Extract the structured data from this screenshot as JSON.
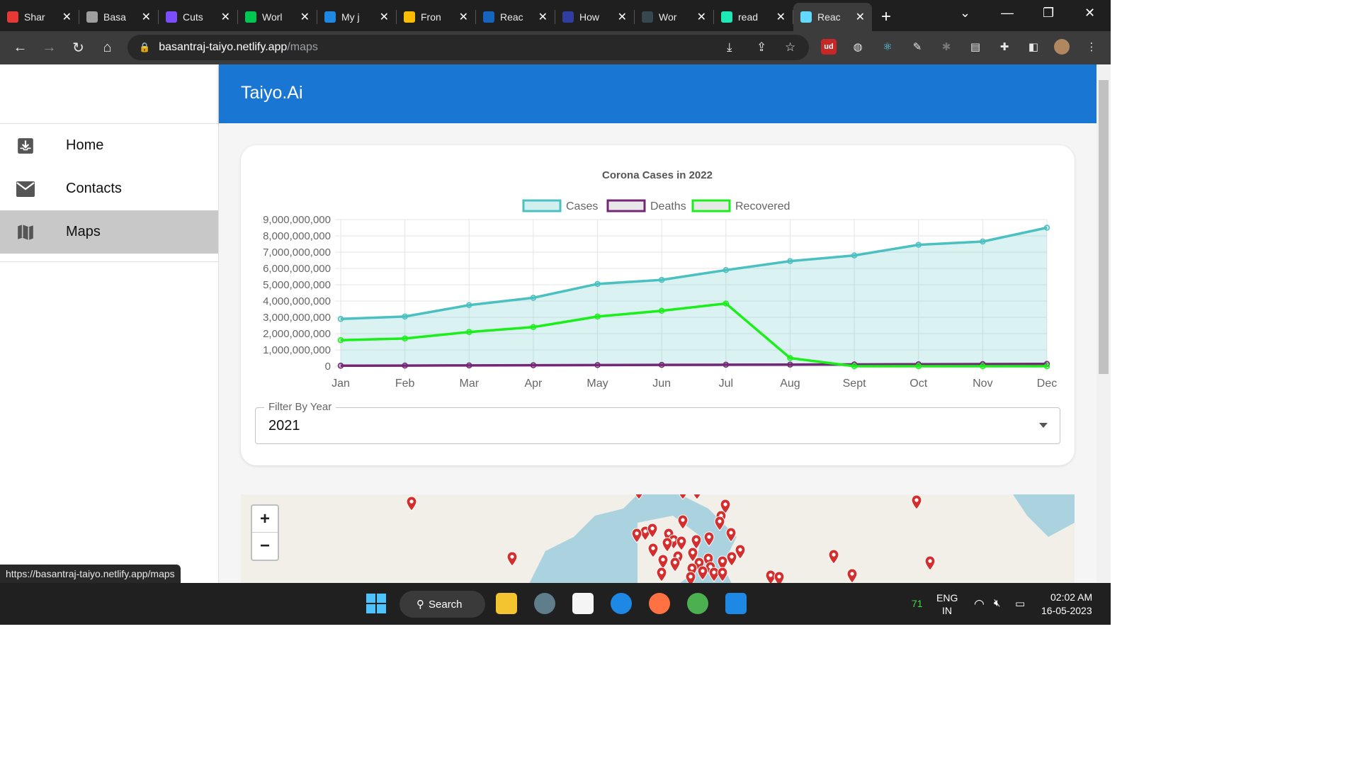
{
  "browser": {
    "tabs": [
      {
        "label": "Shar",
        "color": "#e53935"
      },
      {
        "label": "Basa",
        "color": "#9e9e9e"
      },
      {
        "label": "Cuts",
        "color": "#7c4dff"
      },
      {
        "label": "Worl",
        "color": "#00c853"
      },
      {
        "label": "My j",
        "color": "#1e88e5"
      },
      {
        "label": "Fron",
        "color": "#fbbc04"
      },
      {
        "label": "Reac",
        "color": "#1565c0"
      },
      {
        "label": "How",
        "color": "#303f9f"
      },
      {
        "label": "Wor",
        "color": "#37474f"
      },
      {
        "label": "read",
        "color": "#1de9b6"
      },
      {
        "label": "Reac",
        "color": "#61dafb"
      }
    ],
    "url_host": "basantraj-taiyo.netlify.app",
    "url_path": "/maps",
    "status_url": "https://basantraj-taiyo.netlify.app/maps"
  },
  "app": {
    "title": "Taiyo.Ai",
    "nav": [
      {
        "label": "Home",
        "icon": "inbox-download-icon"
      },
      {
        "label": "Contacts",
        "icon": "mail-icon"
      },
      {
        "label": "Maps",
        "icon": "map-icon"
      }
    ]
  },
  "filter": {
    "label": "Filter By Year",
    "value": "2021"
  },
  "map": {
    "zoom_in": "+",
    "zoom_out": "−"
  },
  "chart_data": {
    "type": "line",
    "title": "Corona Cases in 2022",
    "categories": [
      "Jan",
      "Feb",
      "Mar",
      "Apr",
      "May",
      "Jun",
      "Jul",
      "Aug",
      "Sept",
      "Oct",
      "Nov",
      "Dec"
    ],
    "ylim": [
      0,
      9000000000
    ],
    "yticks": [
      "0",
      "1,000,000,000",
      "2,000,000,000",
      "3,000,000,000",
      "4,000,000,000",
      "5,000,000,000",
      "6,000,000,000",
      "7,000,000,000",
      "8,000,000,000",
      "9,000,000,000"
    ],
    "grid": true,
    "legend": "top",
    "series": [
      {
        "name": "Cases",
        "color": "#4bc0c0",
        "fill": true,
        "values": [
          2900000000,
          3050000000,
          3750000000,
          4200000000,
          5050000000,
          5300000000,
          5900000000,
          6450000000,
          6800000000,
          7450000000,
          7650000000,
          8500000000
        ]
      },
      {
        "name": "Deaths",
        "color": "#742774",
        "fill": false,
        "values": [
          30000000,
          40000000,
          50000000,
          60000000,
          70000000,
          80000000,
          90000000,
          100000000,
          110000000,
          120000000,
          130000000,
          140000000
        ]
      },
      {
        "name": "Recovered",
        "color": "#1aef1a",
        "fill": false,
        "values": [
          1600000000,
          1700000000,
          2100000000,
          2400000000,
          3050000000,
          3400000000,
          3850000000,
          500000000,
          0,
          0,
          0,
          0
        ]
      }
    ]
  },
  "taskbar": {
    "search": "Search",
    "temp": "71",
    "lang1": "ENG",
    "lang2": "IN",
    "time": "02:02 AM",
    "date": "16-05-2023"
  }
}
